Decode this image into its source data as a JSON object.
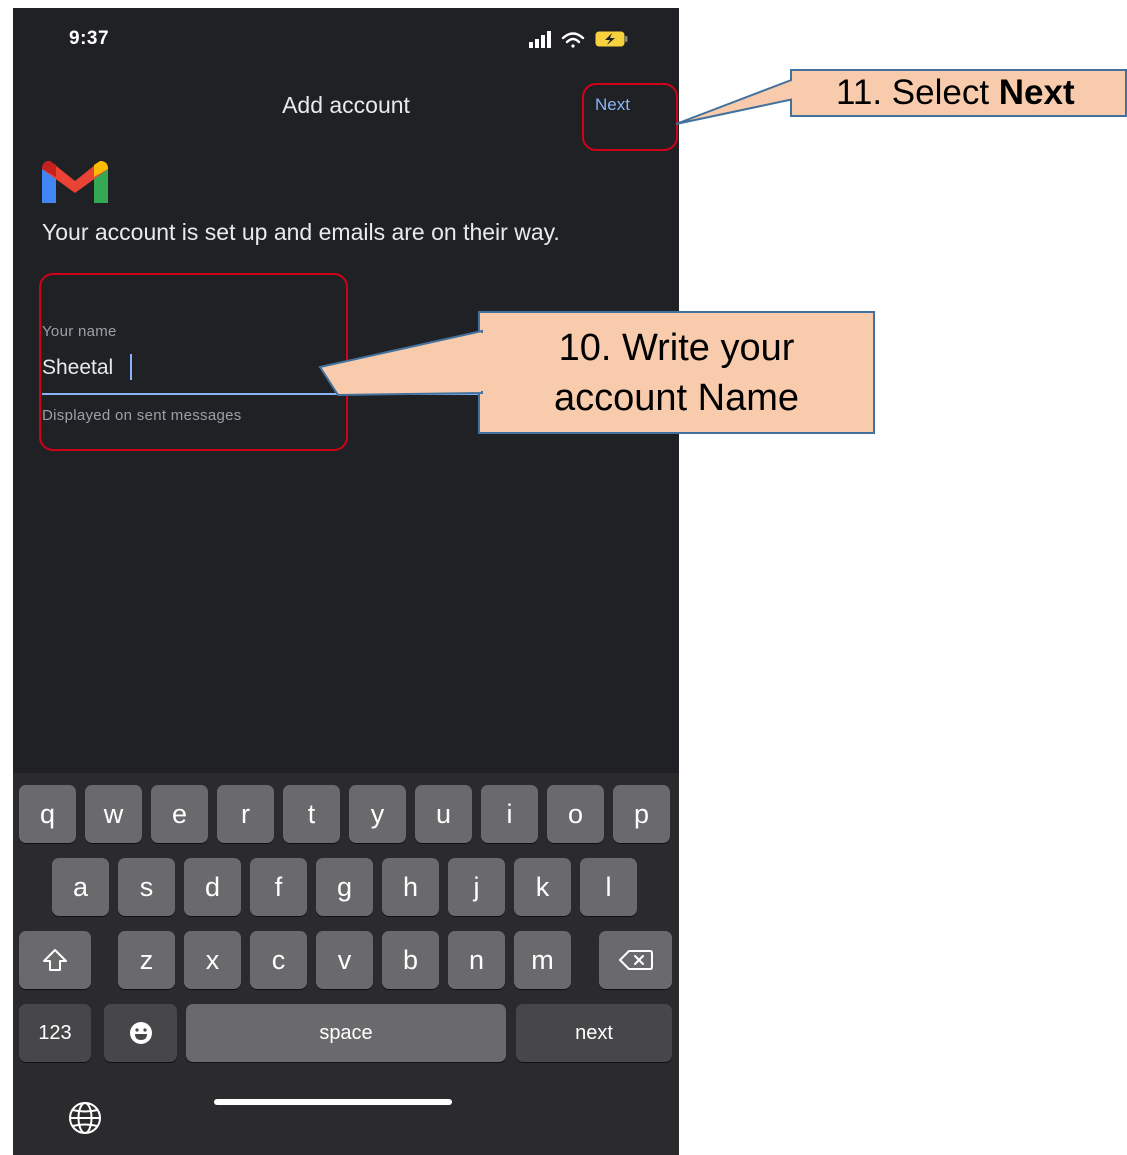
{
  "status_bar": {
    "time": "9:37"
  },
  "header": {
    "title": "Add account",
    "next_label": "Next"
  },
  "content": {
    "message": "Your account is set up and emails are on their way.",
    "name_field": {
      "label": "Your name",
      "value": "Sheetal",
      "helper": "Displayed on sent messages"
    }
  },
  "keyboard": {
    "row1": [
      "q",
      "w",
      "e",
      "r",
      "t",
      "y",
      "u",
      "i",
      "o",
      "p"
    ],
    "row2": [
      "a",
      "s",
      "d",
      "f",
      "g",
      "h",
      "j",
      "k",
      "l"
    ],
    "row3": [
      "z",
      "x",
      "c",
      "v",
      "b",
      "n",
      "m"
    ],
    "numbers_label": "123",
    "space_label": "space",
    "return_label": "next"
  },
  "annotations": {
    "step10": {
      "line1": "10. Write your",
      "line2": "account Name"
    },
    "step11": {
      "prefix": "11. Select ",
      "bold": "Next"
    }
  },
  "colors": {
    "background": "#202124",
    "accent": "#8ab4f8",
    "callout_fill": "#f8cbad",
    "callout_border": "#41719c",
    "highlight": "#d0021b"
  }
}
